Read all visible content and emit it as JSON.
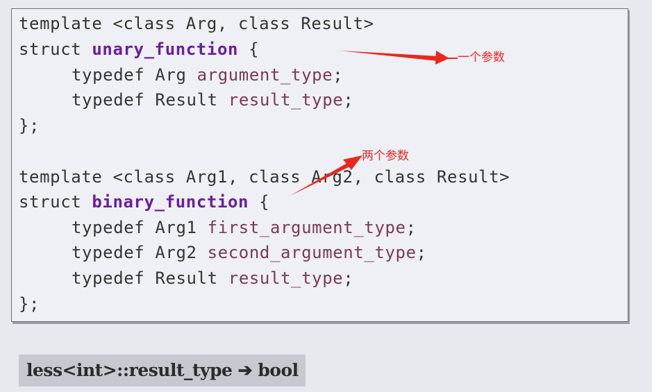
{
  "code": {
    "unary": {
      "template_line": "template <class Arg, class Result>",
      "struct_keyword": "struct ",
      "struct_name": "unary_function",
      "open_brace": " {",
      "members": [
        {
          "kw": "typedef ",
          "type": "Arg ",
          "name": "argument_type",
          "end": ";"
        },
        {
          "kw": "typedef ",
          "type": "Result ",
          "name": "result_type",
          "end": ";"
        }
      ],
      "close": "};"
    },
    "binary": {
      "template_line": "template <class Arg1, class Arg2, class Result>",
      "struct_keyword": "struct ",
      "struct_name": "binary_function",
      "open_brace": " {",
      "members": [
        {
          "kw": "typedef ",
          "type": "Arg1 ",
          "name": "first_argument_type",
          "end": ";"
        },
        {
          "kw": "typedef ",
          "type": "Arg2 ",
          "name": "second_argument_type",
          "end": ";"
        },
        {
          "kw": "typedef ",
          "type": "Result ",
          "name": "result_type",
          "end": ";"
        }
      ],
      "close": "};"
    }
  },
  "annotations": {
    "one_param": "一个参数",
    "two_params": "两个参数",
    "color": "#e8281e"
  },
  "footer": {
    "text": "less<int>::result_type ➔ bool"
  },
  "colors": {
    "function_name": "#6a1ea0",
    "typedef_name": "#7a3a56",
    "code_text": "#343434"
  }
}
